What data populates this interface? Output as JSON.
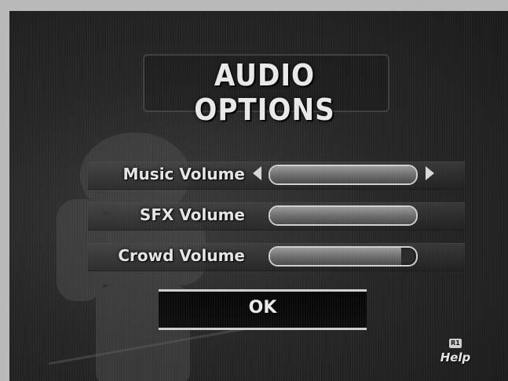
{
  "title": "AUDIO OPTIONS",
  "options": [
    {
      "label": "Music Volume",
      "level": 1.0,
      "selected": true
    },
    {
      "label": "SFX Volume",
      "level": 1.0,
      "selected": false
    },
    {
      "label": "Crowd Volume",
      "level": 0.9,
      "selected": false
    }
  ],
  "ok_label": "OK",
  "help": {
    "button": "R1",
    "label": "Help"
  },
  "colors": {
    "text": "#e4e4e4",
    "accent": "#cfcfcf",
    "background": "#262626"
  }
}
